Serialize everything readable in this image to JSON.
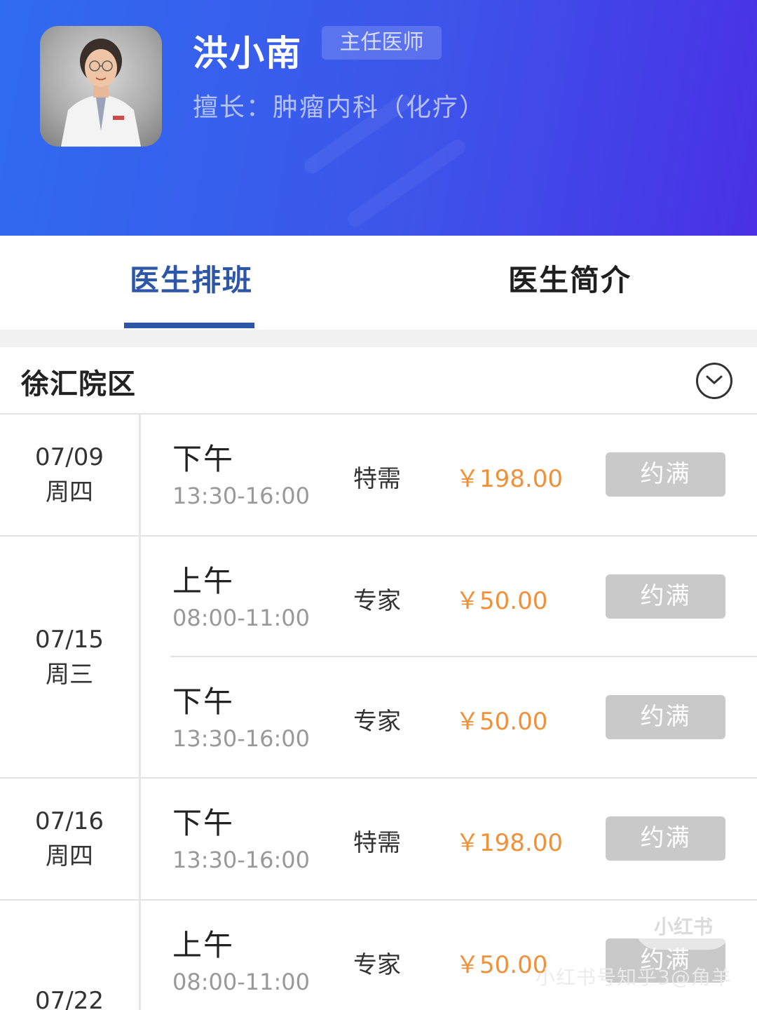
{
  "doctor": {
    "name": "洪小南",
    "title": "主任医师",
    "specialty": "擅长：肿瘤内科（化疗）"
  },
  "tabs": [
    {
      "label": "医生排班",
      "active": true
    },
    {
      "label": "医生简介",
      "active": false
    }
  ],
  "campus": {
    "name": "徐汇院区",
    "toggle_icon": "chevron-down-circle-icon"
  },
  "schedule": [
    {
      "date": "07/09",
      "weekday": "周四",
      "slots": [
        {
          "period": "下午",
          "time": "13:30-16:00",
          "type": "特需",
          "price": "￥198.00",
          "status": "约满"
        }
      ]
    },
    {
      "date": "07/15",
      "weekday": "周三",
      "slots": [
        {
          "period": "上午",
          "time": "08:00-11:00",
          "type": "专家",
          "price": "￥50.00",
          "status": "约满"
        },
        {
          "period": "下午",
          "time": "13:30-16:00",
          "type": "专家",
          "price": "￥50.00",
          "status": "约满"
        }
      ]
    },
    {
      "date": "07/16",
      "weekday": "周四",
      "slots": [
        {
          "period": "下午",
          "time": "13:30-16:00",
          "type": "特需",
          "price": "￥198.00",
          "status": "约满"
        }
      ]
    },
    {
      "date": "07/22",
      "weekday": "",
      "slots": [
        {
          "period": "上午",
          "time": "08:00-11:00",
          "type": "专家",
          "price": "￥50.00",
          "status": "约满"
        }
      ]
    }
  ],
  "watermark": {
    "logo": "小红书",
    "text": "小红书号知乎3@角羊"
  },
  "colors": {
    "header_start": "#2f6bf0",
    "header_end": "#4a30e6",
    "tab_active": "#2d55a8",
    "price": "#f0913a",
    "button_disabled": "#c9c9c9"
  }
}
